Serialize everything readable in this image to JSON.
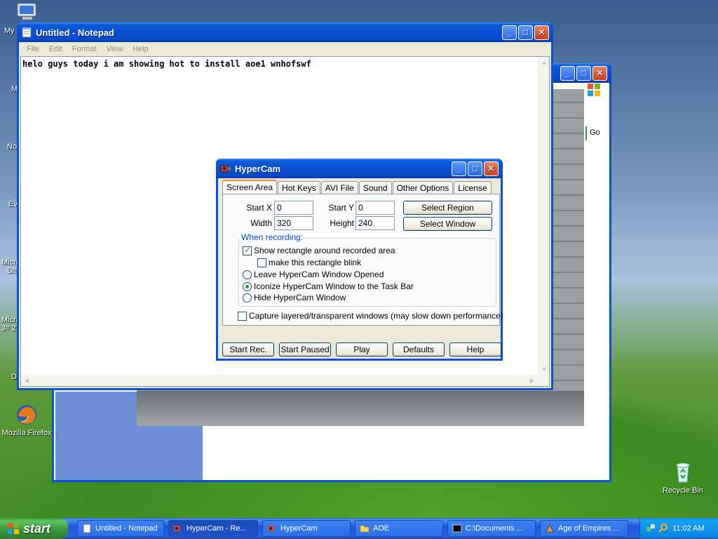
{
  "desktop": {
    "icons": [
      {
        "label": "Mozilla Firefox"
      },
      {
        "label": "Recycle Bin"
      }
    ],
    "partial_labels": [
      "My",
      "M",
      "No",
      "Ev",
      "Micro",
      "Stu",
      "Micro",
      "J# 2",
      "D"
    ]
  },
  "notepad": {
    "title": "Untitled - Notepad",
    "menu": [
      "File",
      "Edit",
      "Format",
      "View",
      "Help"
    ],
    "text": "helo guys today i am showing hot to install aoe1 wnhofswf"
  },
  "back_window": {
    "go_label": "Go"
  },
  "hypercam": {
    "title": "HyperCam",
    "tabs": [
      "Screen Area",
      "Hot Keys",
      "AVI File",
      "Sound",
      "Other Options",
      "License"
    ],
    "start_x_label": "Start X",
    "start_x_value": "0",
    "start_y_label": "Start Y",
    "start_y_value": "0",
    "width_label": "Width",
    "width_value": "320",
    "height_label": "Height",
    "height_value": "240",
    "select_region": "Select Region",
    "select_window": "Select Window",
    "group_label": "When recording:",
    "show_rect": "Show rectangle around recorded area",
    "blink_rect": "make this rectangle blink",
    "leave_opened": "Leave HyperCam Window Opened",
    "iconize": "Iconize HyperCam Window to the Task Bar",
    "hide": "Hide HyperCam Window",
    "capture_layered": "Capture layered/transparent windows (may slow down performance)",
    "buttons": [
      "Start Rec.",
      "Start Paused",
      "Play",
      "Defaults",
      "Help"
    ]
  },
  "taskbar": {
    "start": "start",
    "tasks": [
      "Untitled - Notepad",
      "HyperCam - Re...",
      "HyperCam",
      "AOE",
      "C:\\Documents ...",
      "Age of Empires ..."
    ],
    "clock": "11:02 AM"
  },
  "colors": {
    "xp_blue": "#0a53d9",
    "start_green": "#379437",
    "check_green": "#21a121",
    "window_face": "#ece9d8"
  }
}
